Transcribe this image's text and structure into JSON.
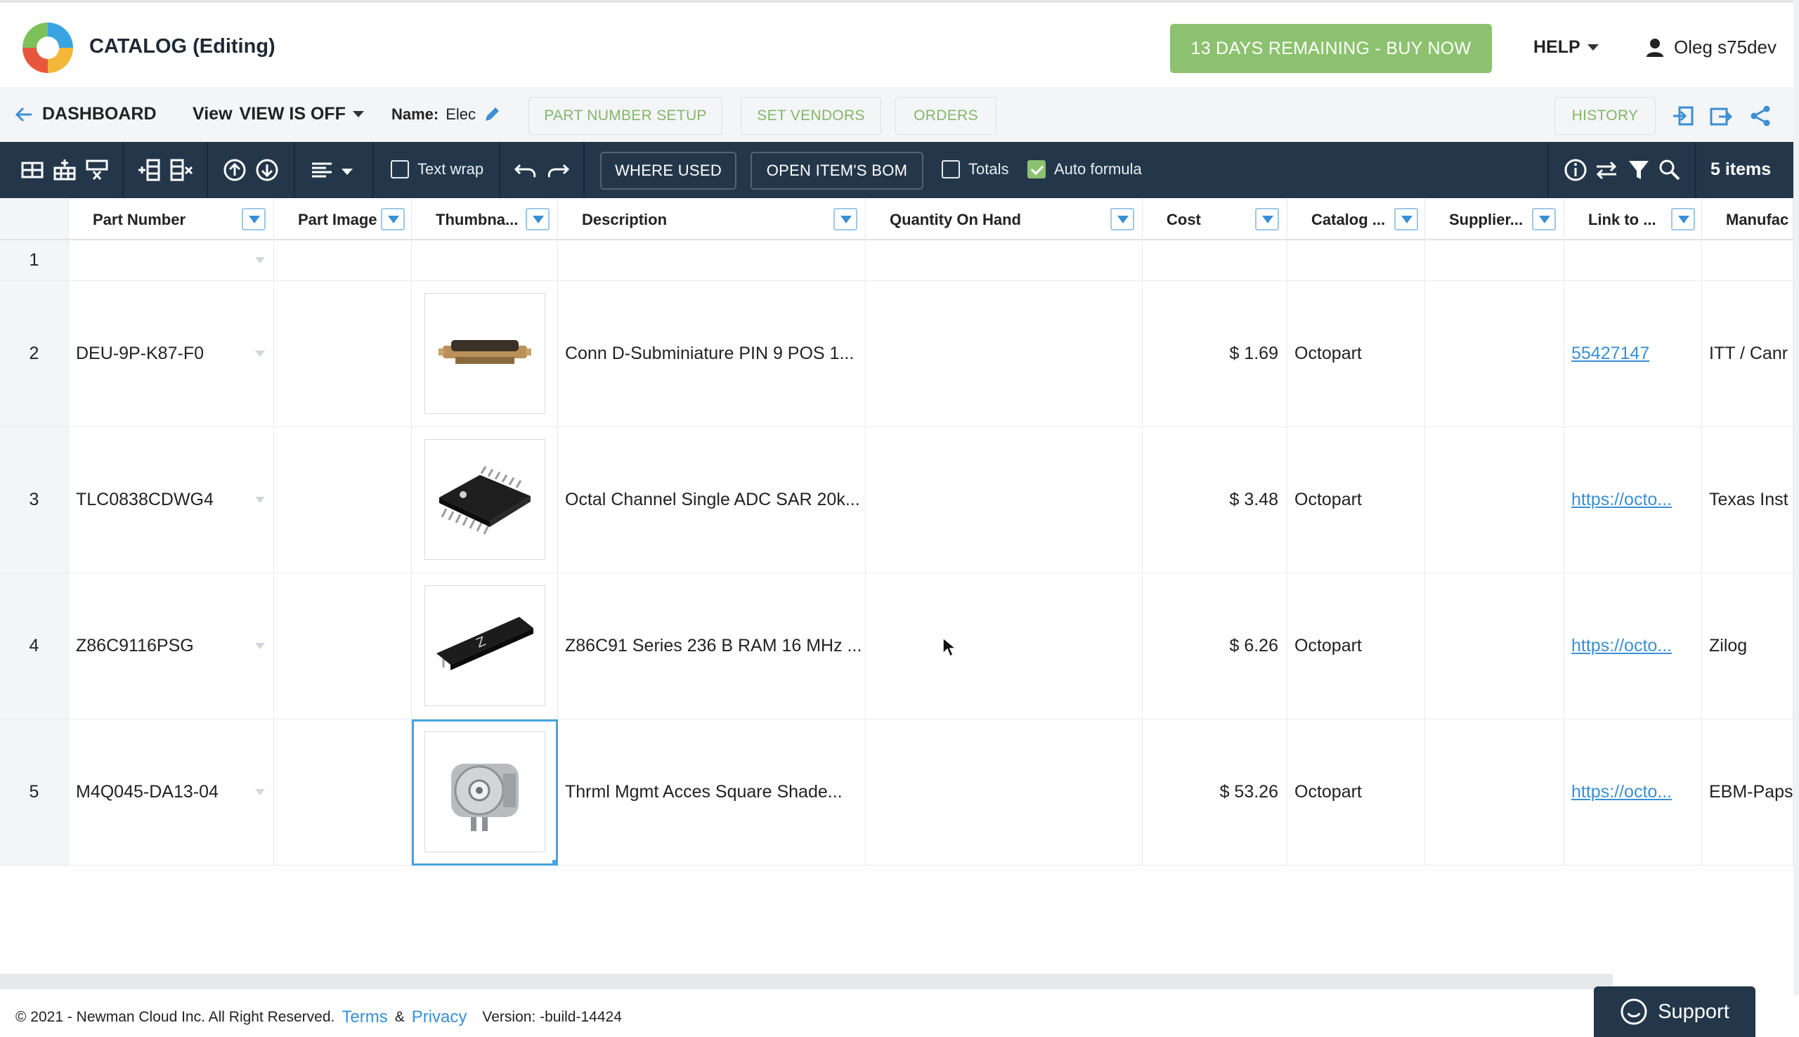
{
  "header": {
    "app_title": "CATALOG (Editing)",
    "trial_button": "13 DAYS REMAINING - BUY NOW",
    "help_label": "HELP",
    "user_name": "Oleg s75dev"
  },
  "subbar": {
    "back_label": "DASHBOARD",
    "view_label": "View",
    "view_value": "VIEW IS OFF",
    "name_label": "Name:",
    "name_value": "Elec",
    "part_number_setup": "PART NUMBER SETUP",
    "set_vendors": "SET VENDORS",
    "orders": "ORDERS",
    "history": "HISTORY"
  },
  "toolbar": {
    "text_wrap": "Text wrap",
    "where_used": "WHERE USED",
    "open_bom": "OPEN ITEM'S BOM",
    "totals": "Totals",
    "auto_formula": "Auto formula",
    "items_count": "5 items",
    "text_wrap_checked": false,
    "totals_checked": false,
    "auto_formula_checked": true
  },
  "columns": [
    "Part Number",
    "Part Image",
    "Thumbna...",
    "Description",
    "Quantity On Hand",
    "Cost",
    "Catalog ...",
    "Supplier...",
    "Link to ...",
    "Manufac"
  ],
  "rows": [
    {
      "num": "1",
      "part": "",
      "desc": "",
      "qty": "",
      "cost": "",
      "catalog": "",
      "supplier": "",
      "link": "",
      "manuf": ""
    },
    {
      "num": "2",
      "part": "DEU-9P-K87-F0",
      "desc": "Conn D-Subminiature PIN 9 POS 1...",
      "qty": "",
      "cost": "$ 1.69",
      "catalog": "Octopart",
      "supplier": "",
      "link": "55427147",
      "manuf": "ITT / Canr"
    },
    {
      "num": "3",
      "part": "TLC0838CDWG4",
      "desc": "Octal Channel Single ADC SAR 20k...",
      "qty": "",
      "cost": "$ 3.48",
      "catalog": "Octopart",
      "supplier": "",
      "link": "https://octo...",
      "manuf": "Texas Inst"
    },
    {
      "num": "4",
      "part": "Z86C9116PSG",
      "desc": "Z86C91 Series 236 B RAM 16 MHz ...",
      "qty": "",
      "cost": "$ 6.26",
      "catalog": "Octopart",
      "supplier": "",
      "link": "https://octo...",
      "manuf": "Zilog"
    },
    {
      "num": "5",
      "part": "M4Q045-DA13-04",
      "desc": "Thrml Mgmt Acces Square Shade...",
      "qty": "",
      "cost": "$ 53.26",
      "catalog": "Octopart",
      "supplier": "",
      "link": "https://octo...",
      "manuf": "EBM-Paps"
    }
  ],
  "footer": {
    "copyright": "© 2021 - Newman Cloud Inc. All Right Reserved.",
    "terms": "Terms",
    "amp": "&",
    "privacy": "Privacy",
    "version": "Version: -build-14424",
    "support": "Support"
  },
  "colors": {
    "accent_green": "#8cc26f",
    "toolbar_navy": "#24374a",
    "link_blue": "#3a8fd6"
  }
}
